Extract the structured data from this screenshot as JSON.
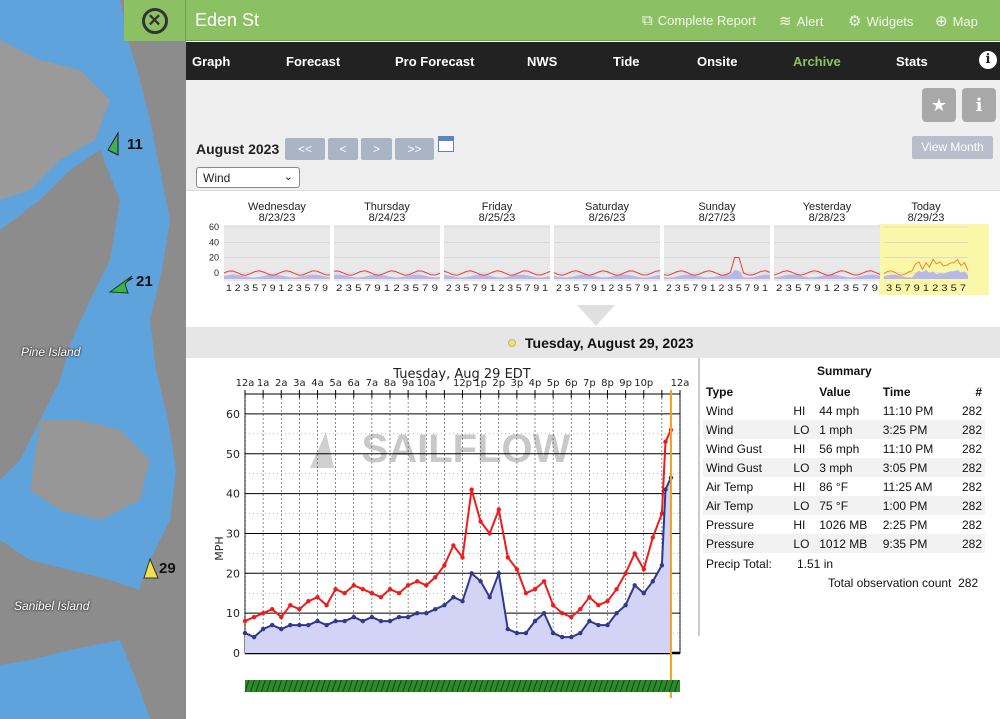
{
  "map": {
    "labels": {
      "pine_island": "Pine Island",
      "sanibel_island": "Sanibel Island"
    },
    "stations": [
      {
        "value": "11",
        "color": "#3cb34a"
      },
      {
        "value": "21",
        "color": "#3cb34a"
      },
      {
        "value": "29",
        "color": "#f1e24c"
      }
    ]
  },
  "header": {
    "title": "Eden St",
    "links": {
      "complete_report": "Complete Report",
      "alert": "Alert",
      "widgets": "Widgets",
      "map": "Map"
    }
  },
  "tabs": [
    "Graph",
    "Forecast",
    "Pro Forecast",
    "NWS",
    "Tide",
    "Onsite",
    "Archive",
    "Stats"
  ],
  "active_tab": "Archive",
  "controls": {
    "month": "August 2023",
    "nav": [
      "<<",
      "<",
      ">",
      ">>"
    ],
    "view_month": "View Month",
    "variable": "Wind"
  },
  "week": {
    "days": [
      {
        "name": "Wednesday",
        "date": "8/23/23"
      },
      {
        "name": "Thursday",
        "date": "8/24/23"
      },
      {
        "name": "Friday",
        "date": "8/25/23"
      },
      {
        "name": "Saturday",
        "date": "8/26/23"
      },
      {
        "name": "Sunday",
        "date": "8/27/23"
      },
      {
        "name": "Yesterday",
        "date": "8/28/23"
      },
      {
        "name": "Today",
        "date": "8/29/23"
      }
    ],
    "y_ticks": [
      "60",
      "40",
      "20",
      "0"
    ],
    "x_tick_labels": [
      "1 2 3 5 7 9 1 2 3 5 7 9",
      "2 3 5 7 9 1 2 3 5 7 9",
      "2 3 5 7 9 1 2 3 5 7 9 1",
      "2 3 5 7 9 1 2 3 5 7 9 1",
      "2 3 5 7 9 1 2 3 5 7 9 1",
      "2 3 5 7 9 1 2 3 5 7 9",
      "3 5 7 9 1 2 3 5 7"
    ],
    "today_highlight": "#fbf7a8"
  },
  "selected_date": "Tuesday, August 29, 2023",
  "chart_data": {
    "type": "line",
    "title": "Tuesday, Aug 29 EDT",
    "ylabel": "MPH",
    "ylim": [
      0,
      65
    ],
    "watermark": "SAILFLOW",
    "x_ticks": [
      "12a",
      "1a",
      "2a",
      "3a",
      "4a",
      "5a",
      "6a",
      "7a",
      "8a",
      "9a",
      "10a",
      "12p",
      "1p",
      "2p",
      "3p",
      "4p",
      "5p",
      "6p",
      "7p",
      "8p",
      "9p",
      "10p",
      "12a"
    ],
    "y_ticks": [
      "60",
      "50",
      "40",
      "30",
      "20",
      "10",
      "0"
    ],
    "hours": [
      0,
      0.5,
      1,
      1.5,
      2,
      2.5,
      3,
      3.5,
      4,
      4.5,
      5,
      5.5,
      6,
      6.5,
      7,
      7.5,
      8,
      8.5,
      9,
      9.5,
      10,
      10.5,
      11,
      11.5,
      12,
      12.5,
      13,
      13.5,
      14,
      14.5,
      15,
      15.5,
      16,
      16.5,
      17,
      17.5,
      18,
      18.5,
      19,
      19.5,
      20,
      20.5,
      21,
      21.5,
      22,
      22.5,
      23,
      23.2,
      23.5
    ],
    "series": [
      {
        "name": "Wind Gust",
        "color": "#ee1c1c",
        "values": [
          8,
          9,
          10,
          11,
          9,
          12,
          11,
          13,
          14,
          12,
          16,
          15,
          17,
          16,
          15,
          14,
          16,
          15,
          17,
          18,
          17,
          19,
          22,
          27,
          24,
          41,
          33,
          30,
          36,
          24,
          21,
          15,
          16,
          18,
          12,
          10,
          9,
          11,
          14,
          12,
          13,
          16,
          20,
          25,
          21,
          29,
          35,
          53,
          56
        ]
      },
      {
        "name": "Wind",
        "color": "#2f3a8e",
        "values": [
          5,
          4,
          6,
          7,
          6,
          7,
          7,
          7,
          8,
          7,
          8,
          8,
          9,
          8,
          9,
          8,
          8,
          9,
          9,
          10,
          10,
          11,
          12,
          14,
          13,
          20,
          18,
          14,
          20,
          6,
          5,
          5,
          8,
          10,
          5,
          4,
          4,
          5,
          8,
          7,
          7,
          10,
          12,
          17,
          15,
          18,
          22,
          41,
          44
        ]
      }
    ]
  },
  "summary": {
    "title": "Summary",
    "headers": [
      "Type",
      "Value",
      "Time",
      "#"
    ],
    "rows": [
      [
        "Wind",
        "HI",
        "44 mph",
        "11:10 PM",
        "282"
      ],
      [
        "Wind",
        "LO",
        "1 mph",
        "3:25 PM",
        "282"
      ],
      [
        "Wind Gust",
        "HI",
        "56 mph",
        "11:10 PM",
        "282"
      ],
      [
        "Wind Gust",
        "LO",
        "3 mph",
        "3:05 PM",
        "282"
      ],
      [
        "Air Temp",
        "HI",
        "86 °F",
        "11:25 AM",
        "282"
      ],
      [
        "Air Temp",
        "LO",
        "75 °F",
        "1:00 PM",
        "282"
      ],
      [
        "Pressure",
        "HI",
        "1026 MB",
        "2:25 PM",
        "282"
      ],
      [
        "Pressure",
        "LO",
        "1012 MB",
        "9:35 PM",
        "282"
      ]
    ],
    "precip_label": "Precip Total:",
    "precip_value": "1.51 in",
    "total_label": "Total observation count",
    "total_value": "282"
  }
}
